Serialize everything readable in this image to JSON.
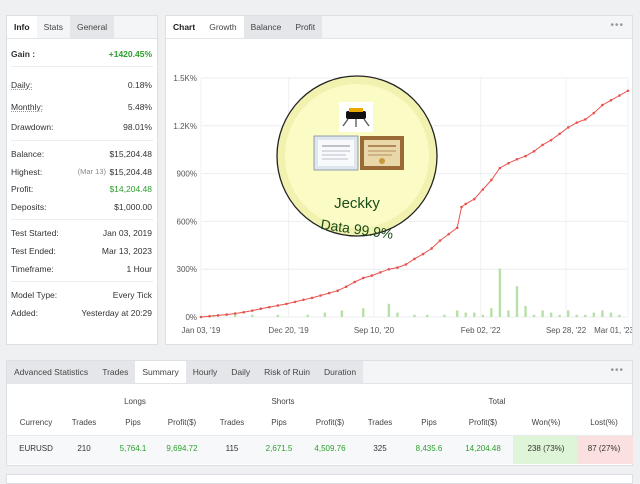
{
  "info_panel": {
    "tabs": [
      "Info",
      "Stats",
      "General"
    ],
    "gain": {
      "label": "Gain :",
      "value": "+1420.45%"
    },
    "daily": {
      "label": "Daily:",
      "value": "0.18%"
    },
    "monthly": {
      "label": "Monthly:",
      "value": "5.48%"
    },
    "drawdown": {
      "label": "Drawdown:",
      "value": "98.01%"
    },
    "balance": {
      "label": "Balance:",
      "value": "$15,204.48"
    },
    "highest": {
      "label": "Highest:",
      "date": "(Mar 13)",
      "value": "$15,204.48"
    },
    "profit": {
      "label": "Profit:",
      "value": "$14,204.48"
    },
    "deposits": {
      "label": "Deposits:",
      "value": "$1,000.00"
    },
    "test_started": {
      "label": "Test Started:",
      "value": "Jan 03, 2019"
    },
    "test_ended": {
      "label": "Test Ended:",
      "value": "Mar 13, 2023"
    },
    "timeframe": {
      "label": "Timeframe:",
      "value": "1 Hour"
    },
    "model_type": {
      "label": "Model Type:",
      "value": "Every Tick"
    },
    "added": {
      "label": "Added:",
      "value": "Yesterday at 20:29"
    }
  },
  "chart_panel": {
    "tabs": [
      "Chart",
      "Growth",
      "Balance",
      "Profit"
    ],
    "menu": "•••",
    "watermark": {
      "name": "Jeckky",
      "tagline": "Data 99.9%"
    }
  },
  "chart_data": {
    "type": "line",
    "x_tick_labels": [
      "Jan 03, '19",
      "Dec 20, '19",
      "Sep 10, '20",
      "Feb 02, '22",
      "Sep 28, '22",
      "Mar 01, '23"
    ],
    "y_tick_labels": [
      "0%",
      "300%",
      "600%",
      "900%",
      "1.2K%",
      "1.5K%"
    ],
    "ylim": [
      0,
      1500
    ],
    "grid": true,
    "series": [
      {
        "color": "#e8534f",
        "x": [
          0,
          2,
          4,
          6,
          8,
          10,
          12,
          14,
          16,
          18,
          20,
          22,
          24,
          26,
          28,
          30,
          32,
          34,
          36,
          38,
          40,
          42,
          44,
          46,
          48,
          50,
          52,
          54,
          56,
          58,
          60,
          61,
          62,
          64,
          66,
          68,
          70,
          72,
          74,
          76,
          78,
          80,
          82,
          84,
          86,
          88,
          90,
          92,
          94,
          96,
          98,
          100
        ],
        "values": [
          0,
          5,
          10,
          15,
          22,
          30,
          40,
          52,
          62,
          72,
          82,
          95,
          108,
          120,
          135,
          150,
          165,
          190,
          220,
          245,
          260,
          280,
          300,
          310,
          330,
          365,
          395,
          430,
          480,
          520,
          560,
          690,
          710,
          740,
          800,
          860,
          935,
          965,
          990,
          1010,
          1040,
          1080,
          1110,
          1150,
          1190,
          1220,
          1240,
          1280,
          1330,
          1360,
          1390,
          1420
        ]
      }
    ],
    "volume_bars": {
      "color": "#b7e0a6",
      "x": [
        3,
        8,
        12,
        18,
        25,
        29,
        33,
        38,
        44,
        46,
        50,
        53,
        57,
        60,
        62,
        64,
        66,
        68,
        70,
        72,
        74,
        76,
        78,
        80,
        82,
        84,
        86,
        88,
        90,
        92,
        94,
        96,
        98
      ],
      "values": [
        1,
        2,
        1,
        1,
        1,
        2,
        3,
        4,
        6,
        2,
        1,
        1,
        1,
        3,
        2,
        2,
        1,
        4,
        22,
        3,
        14,
        5,
        1,
        3,
        2,
        1,
        3,
        1,
        1,
        2,
        3,
        2,
        1
      ]
    }
  },
  "advanced_stats": {
    "tabs": [
      "Advanced Statistics",
      "Trades",
      "Summary",
      "Hourly",
      "Daily",
      "Risk of Ruin",
      "Duration"
    ],
    "menu": "•••",
    "groups": {
      "longs": "Longs",
      "shorts": "Shorts",
      "total": "Total"
    },
    "columns": [
      "Currency",
      "Trades",
      "Pips",
      "Profit($)",
      "Trades",
      "Pips",
      "Profit($)",
      "Trades",
      "Pips",
      "Profit($)",
      "Won(%)",
      "Lost(%)"
    ],
    "rows": [
      [
        "EURUSD",
        "210",
        "5,764.1",
        "9,694.72",
        "115",
        "2,671.5",
        "4,509.76",
        "325",
        "8,435.6",
        "14,204.48",
        "238 (73%)",
        "87 (27%)"
      ]
    ]
  }
}
